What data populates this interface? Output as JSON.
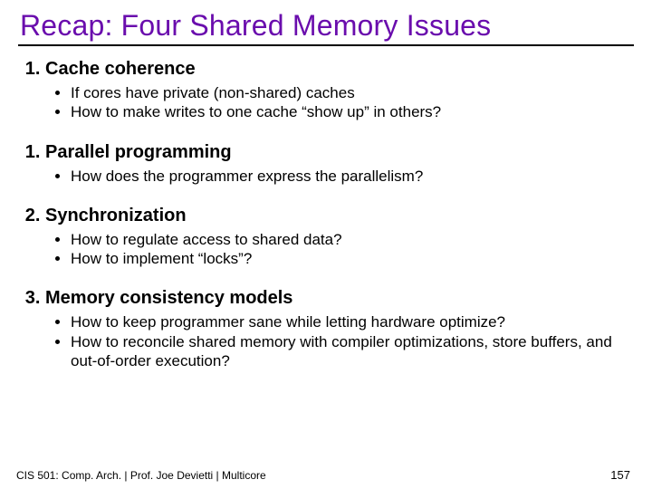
{
  "title": "Recap: Four Shared Memory Issues",
  "items": [
    {
      "num": "1",
      "heading": "Cache coherence",
      "bullets": [
        "If cores have private (non-shared) caches",
        "How to make writes to one cache “show up” in others?"
      ]
    },
    {
      "num": "1",
      "heading": "Parallel programming",
      "bullets": [
        "How does the programmer express the parallelism?"
      ]
    },
    {
      "num": "2",
      "heading": "Synchronization",
      "bullets": [
        "How to regulate access to shared data?",
        "How to implement “locks”?"
      ]
    },
    {
      "num": "3",
      "heading": "Memory consistency models",
      "bullets": [
        "How to keep programmer sane while letting hardware optimize?",
        "How to reconcile shared memory with compiler optimizations, store buffers, and out-of-order execution?"
      ]
    }
  ],
  "footer": "CIS 501: Comp. Arch.  |  Prof. Joe Devietti  |  Multicore",
  "page": "157"
}
